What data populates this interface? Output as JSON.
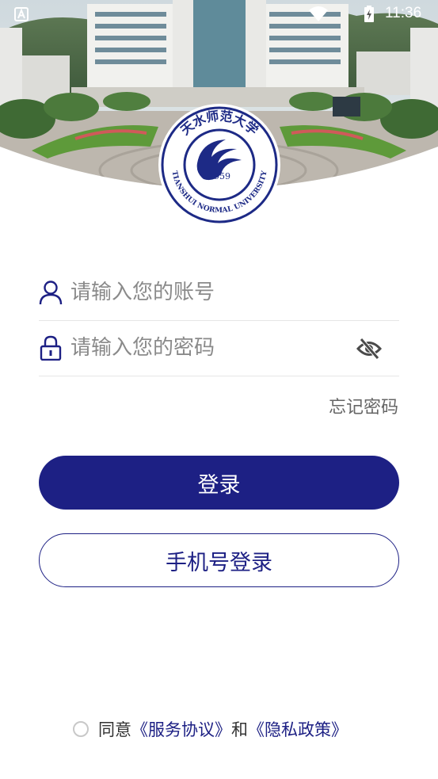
{
  "status_bar": {
    "time": "11:36",
    "left_icon": "android-a-icon",
    "wifi_icon": "wifi-icon",
    "battery_icon": "battery-charging-icon"
  },
  "logo": {
    "top_text": "天水师范大学",
    "year": "1959",
    "bottom_text": "TIANSHUI NORMAL UNIVERSITY"
  },
  "form": {
    "account_placeholder": "请输入您的账号",
    "password_placeholder": "请输入您的密码",
    "account_icon": "user-icon",
    "password_icon": "lock-icon",
    "toggle_icon": "eye-off-icon",
    "forgot_label": "忘记密码"
  },
  "buttons": {
    "login_label": "登录",
    "phone_login_label": "手机号登录"
  },
  "agreement": {
    "prefix": "同意",
    "service_link": "《服务协议》",
    "conjunction": "和",
    "privacy_link": "《隐私政策》"
  },
  "colors": {
    "primary": "#1d2084",
    "placeholder": "#8a8a8a",
    "divider": "#e6e6e6"
  }
}
